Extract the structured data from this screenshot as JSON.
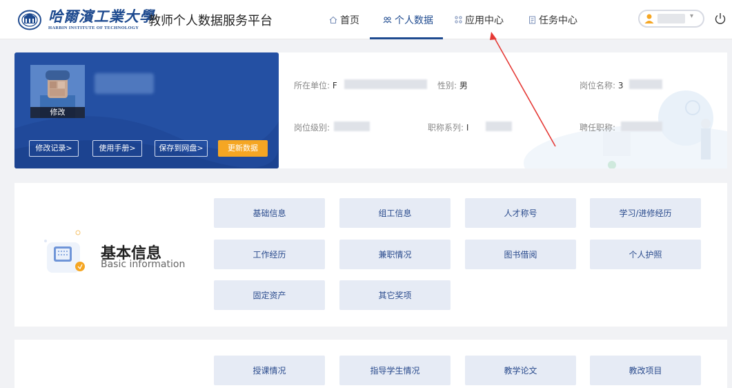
{
  "header": {
    "logo_cn": "哈爾濱工業大學",
    "logo_en": "HARBIN INSTITUTE OF TECHNOLOGY",
    "platform_title": "教师个人数据服务平台",
    "nav": [
      {
        "label": "首页",
        "icon": "home-icon",
        "active": false
      },
      {
        "label": "个人数据",
        "icon": "person-data-icon",
        "active": true
      },
      {
        "label": "应用中心",
        "icon": "apps-grid-icon",
        "active": false
      },
      {
        "label": "任务中心",
        "icon": "task-doc-icon",
        "active": false
      }
    ]
  },
  "profile": {
    "edit_photo": "修改",
    "buttons": {
      "history": "修改记录>",
      "manual": "使用手册>",
      "save_disk": "保存到网盘>",
      "update": "更新数据"
    }
  },
  "info": {
    "unit_label": "所在单位:",
    "unit_value_prefix": "F",
    "gender_label": "性别:",
    "gender_value": "男",
    "post_name_label": "岗位名称:",
    "post_name_value_prefix": "3",
    "post_level_label": "岗位级别:",
    "title_series_label": "职称系列:",
    "title_series_value_prefix": "I",
    "appointed_title_label": "聘任职称:"
  },
  "basic_section": {
    "title": "基本信息",
    "subtitle": "Basic information",
    "tiles": [
      "基础信息",
      "组工信息",
      "人才称号",
      "学习/进修经历",
      "工作经历",
      "兼职情况",
      "图书借阅",
      "个人护照",
      "固定资产",
      "其它奖项"
    ]
  },
  "teaching_section": {
    "tiles": [
      "授课情况",
      "指导学生情况",
      "教学论文",
      "教改项目"
    ]
  },
  "colors": {
    "brand_blue": "#1e4a8f",
    "card_blue": "#2450a3",
    "update_orange": "#f5a623",
    "tile_bg": "#e6ebf5",
    "annotation_red": "#e53935"
  }
}
